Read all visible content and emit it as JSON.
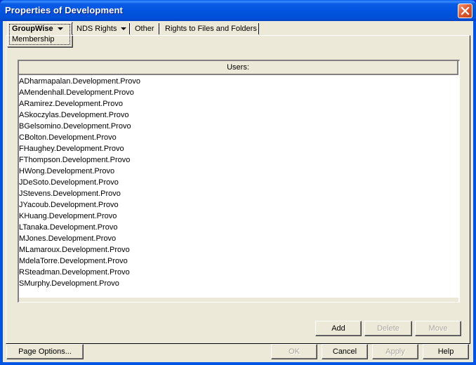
{
  "window": {
    "title": "Properties of Development",
    "close_icon": "close-x-icon"
  },
  "tabs": [
    {
      "label": "GroupWise",
      "sub_label": "Membership",
      "has_dropdown": true,
      "active": true
    },
    {
      "label": "NDS Rights",
      "has_dropdown": true,
      "active": false
    },
    {
      "label": "Other",
      "has_dropdown": false,
      "active": false
    },
    {
      "label": "Rights to Files and Folders",
      "has_dropdown": false,
      "active": false
    }
  ],
  "users_list": {
    "header": "Users:",
    "items": [
      "ADharmapalan.Development.Provo",
      "AMendenhall.Development.Provo",
      "ARamirez.Development.Provo",
      "ASkoczylas.Development.Provo",
      "BGelsomino.Development.Provo",
      "CBolton.Development.Provo",
      "FHaughey.Development.Provo",
      "FThompson.Development.Provo",
      "HWong.Development.Provo",
      "JDeSoto.Development.Provo",
      "JStevens.Development.Provo",
      "JYacoub.Development.Provo",
      "KHuang.Development.Provo",
      "LTanaka.Development.Provo",
      "MJones.Development.Provo",
      "MLamaroux.Development.Provo",
      "MdelaTorre.Development.Provo",
      "RSteadman.Development.Provo",
      "SMurphy.Development.Provo"
    ]
  },
  "list_buttons": {
    "add": {
      "label": "Add",
      "enabled": true
    },
    "delete": {
      "label": "Delete",
      "enabled": false
    },
    "move": {
      "label": "Move",
      "enabled": false
    }
  },
  "footer_buttons": {
    "page_options": {
      "label": "Page Options...",
      "enabled": true
    },
    "ok": {
      "label": "OK",
      "enabled": false
    },
    "cancel": {
      "label": "Cancel",
      "enabled": true
    },
    "apply": {
      "label": "Apply",
      "enabled": false
    },
    "help": {
      "label": "Help",
      "enabled": true
    }
  }
}
